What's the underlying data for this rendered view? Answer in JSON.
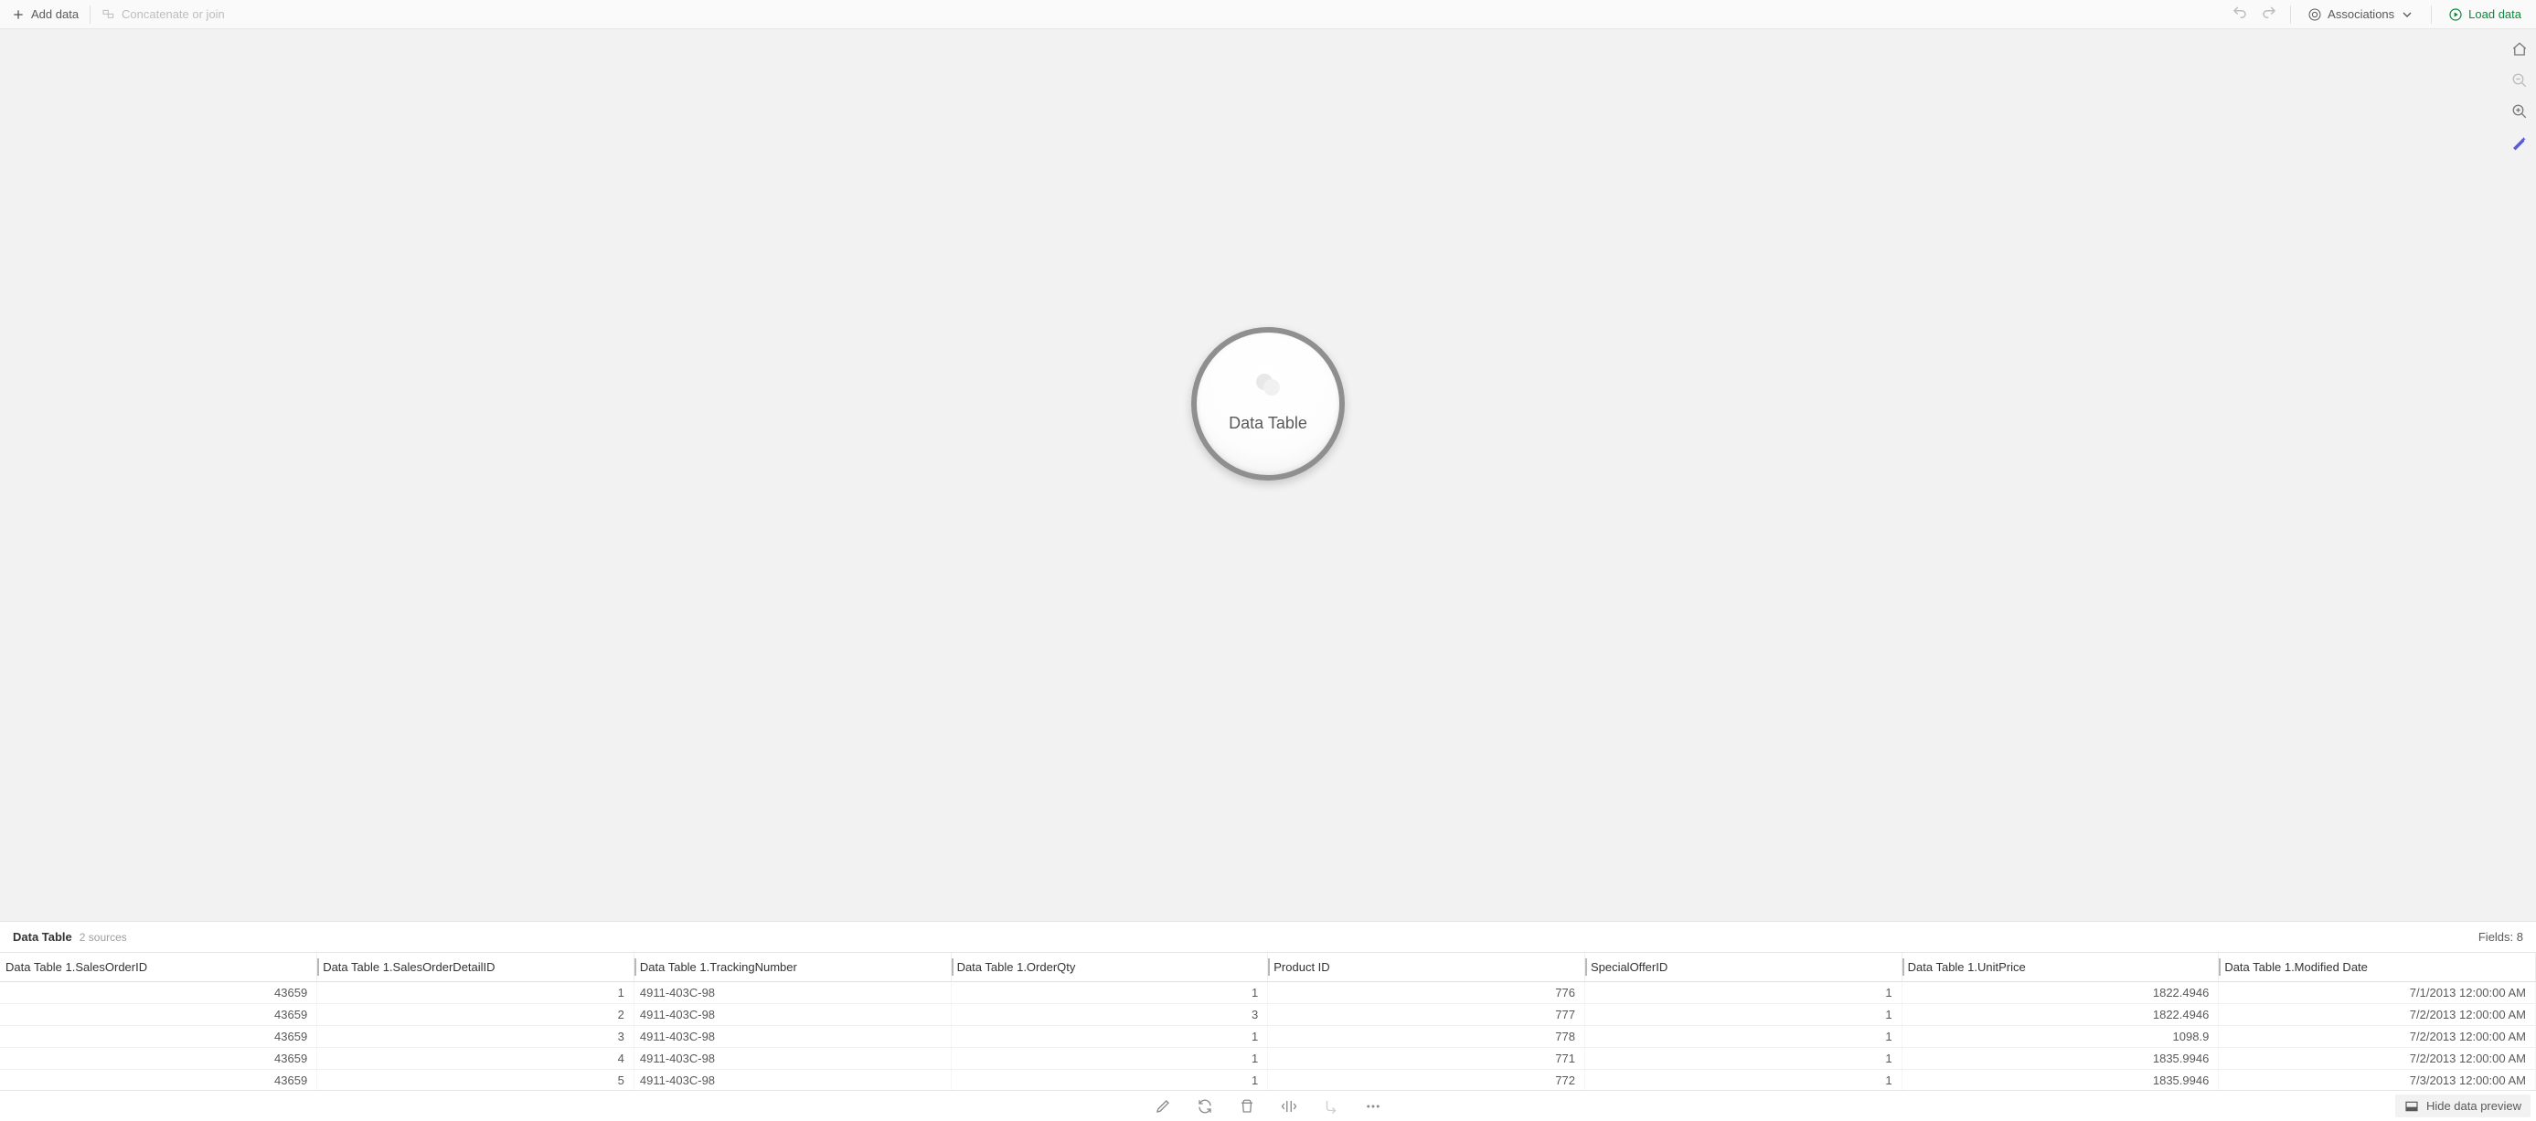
{
  "toolbar": {
    "add_data": "Add data",
    "concat_join": "Concatenate or join",
    "associations": "Associations",
    "load_data": "Load data"
  },
  "canvas": {
    "bubble_label": "Data Table"
  },
  "preview": {
    "title": "Data Table",
    "sources": "2 sources",
    "fields_label": "Fields: 8",
    "columns": [
      "Data Table 1.SalesOrderID",
      "Data Table 1.SalesOrderDetailID",
      "Data Table 1.TrackingNumber",
      "Data Table 1.OrderQty",
      "Product ID",
      "SpecialOfferID",
      "Data Table 1.UnitPrice",
      "Data Table 1.Modified Date"
    ],
    "col_align": [
      "num",
      "num",
      "txt",
      "num",
      "num",
      "num",
      "num",
      "num"
    ],
    "rows": [
      [
        "43659",
        "1",
        "4911-403C-98",
        "1",
        "776",
        "1",
        "1822.4946",
        "7/1/2013 12:00:00 AM"
      ],
      [
        "43659",
        "2",
        "4911-403C-98",
        "3",
        "777",
        "1",
        "1822.4946",
        "7/2/2013 12:00:00 AM"
      ],
      [
        "43659",
        "3",
        "4911-403C-98",
        "1",
        "778",
        "1",
        "1098.9",
        "7/2/2013 12:00:00 AM"
      ],
      [
        "43659",
        "4",
        "4911-403C-98",
        "1",
        "771",
        "1",
        "1835.9946",
        "7/2/2013 12:00:00 AM"
      ],
      [
        "43659",
        "5",
        "4911-403C-98",
        "1",
        "772",
        "1",
        "1835.9946",
        "7/3/2013 12:00:00 AM"
      ]
    ]
  },
  "footer": {
    "hide_preview": "Hide data preview"
  }
}
